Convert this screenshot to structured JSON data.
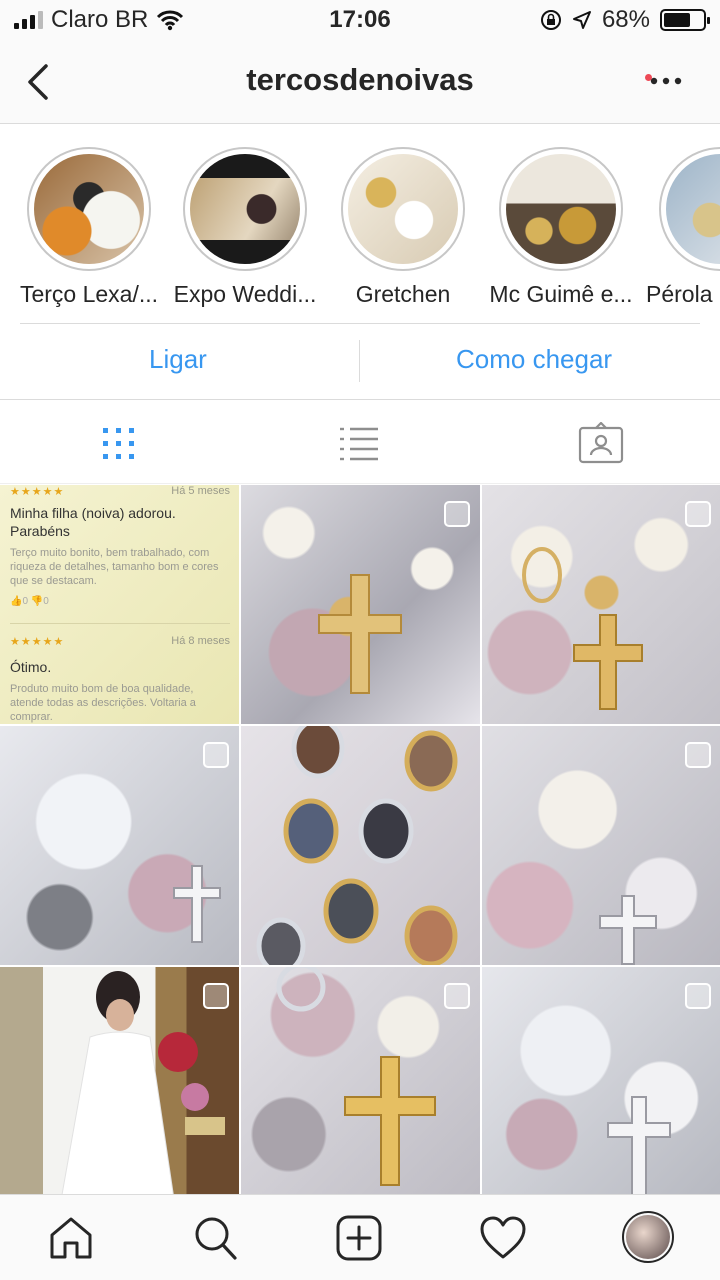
{
  "status_bar": {
    "carrier": "Claro BR",
    "time": "17:06",
    "battery": "68%",
    "battery_level": 0.68
  },
  "header": {
    "title": "tercosdenoivas"
  },
  "highlights": [
    {
      "label": "Terço Lexa/..."
    },
    {
      "label": "Expo Weddi..."
    },
    {
      "label": "Gretchen"
    },
    {
      "label": "Mc Guimê e..."
    },
    {
      "label": "Pérola"
    }
  ],
  "actions": {
    "call": "Ligar",
    "directions": "Como chegar"
  },
  "review_post": {
    "reviews": [
      {
        "stars": "★★★★★",
        "date": "Há 5 meses",
        "title": "Minha filha (noiva) adorou. Parabéns",
        "body": "Terço muito bonito, bem trabalhado, com riqueza de detalhes, tamanho bom e cores que se destacam.",
        "votes": "👍0  👎0"
      },
      {
        "stars": "★★★★★",
        "date": "Há 8 meses",
        "title": "Ótimo.",
        "body": "Produto muito bom de boa qualidade, atende todas as descrições. Voltaria a comprar.",
        "votes": ""
      }
    ]
  },
  "colors": {
    "link_blue": "#3897f0",
    "tab_active": "#3897f0",
    "tab_inactive": "#8e8e8e",
    "notification": "#ed4956"
  },
  "icons": {
    "back": "chevron-left-icon",
    "more": "more-dots-icon",
    "grid": "grid-icon",
    "list": "list-icon",
    "tagged": "tagged-person-icon",
    "home": "home-icon",
    "search": "search-icon",
    "add": "add-post-icon",
    "activity": "heart-icon",
    "profile": "profile-avatar"
  }
}
